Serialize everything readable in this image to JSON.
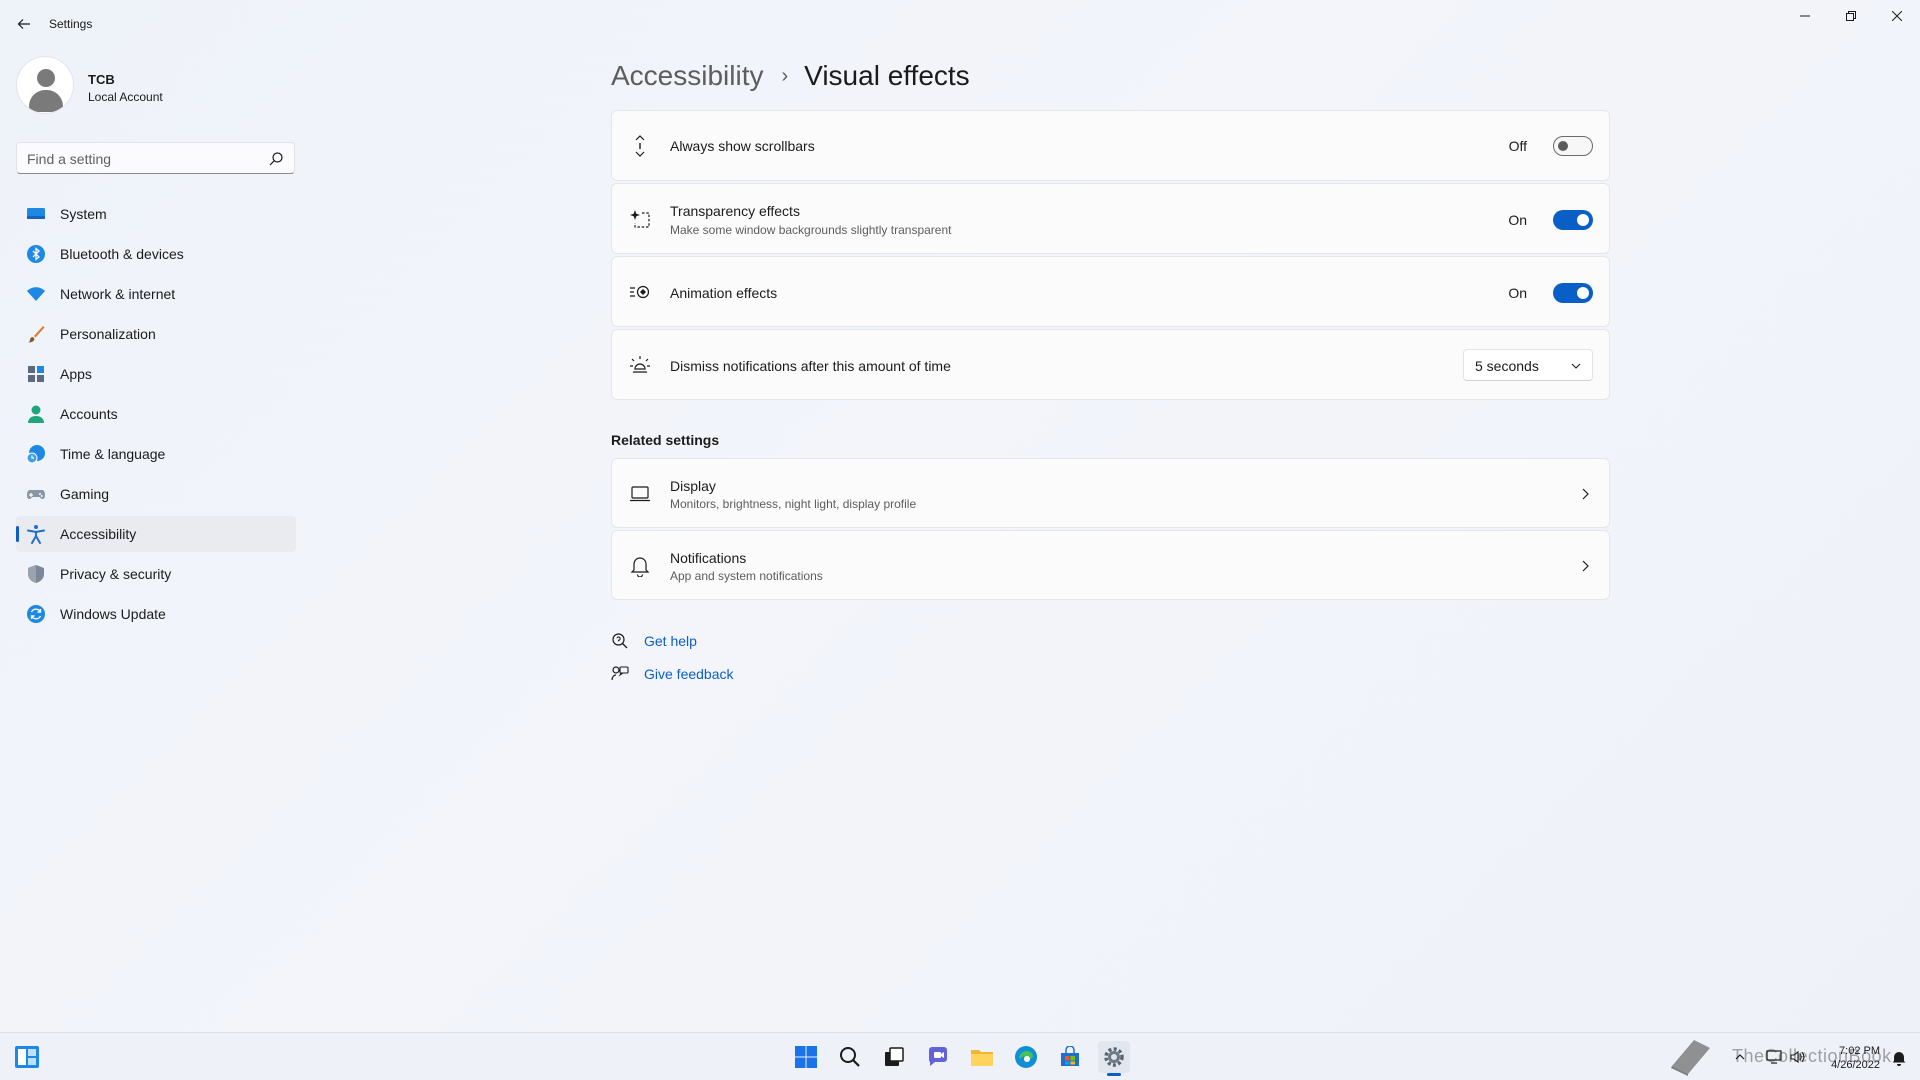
{
  "window": {
    "title": "Settings"
  },
  "profile": {
    "name": "TCB",
    "account_type": "Local Account"
  },
  "search": {
    "placeholder": "Find a setting"
  },
  "sidebar": {
    "items": [
      {
        "label": "System",
        "icon": "system-icon"
      },
      {
        "label": "Bluetooth & devices",
        "icon": "bluetooth-icon"
      },
      {
        "label": "Network & internet",
        "icon": "wifi-icon"
      },
      {
        "label": "Personalization",
        "icon": "brush-icon"
      },
      {
        "label": "Apps",
        "icon": "apps-icon"
      },
      {
        "label": "Accounts",
        "icon": "accounts-icon"
      },
      {
        "label": "Time & language",
        "icon": "time-language-icon"
      },
      {
        "label": "Gaming",
        "icon": "gamepad-icon"
      },
      {
        "label": "Accessibility",
        "icon": "accessibility-icon",
        "active": true
      },
      {
        "label": "Privacy & security",
        "icon": "shield-icon"
      },
      {
        "label": "Windows Update",
        "icon": "update-icon"
      }
    ]
  },
  "breadcrumb": {
    "parent": "Accessibility",
    "separator": "›",
    "current": "Visual effects"
  },
  "settings": {
    "scrollbars": {
      "title": "Always show scrollbars",
      "state": "Off",
      "on": false
    },
    "transparency": {
      "title": "Transparency effects",
      "description": "Make some window backgrounds slightly transparent",
      "state": "On",
      "on": true
    },
    "animation": {
      "title": "Animation effects",
      "state": "On",
      "on": true
    },
    "notifications_dismiss": {
      "title": "Dismiss notifications after this amount of time",
      "value": "5 seconds"
    }
  },
  "related": {
    "heading": "Related settings",
    "display": {
      "title": "Display",
      "description": "Monitors, brightness, night light, display profile"
    },
    "notifications": {
      "title": "Notifications",
      "description": "App and system notifications"
    }
  },
  "help": {
    "get_help": "Get help",
    "give_feedback": "Give feedback"
  },
  "taskbar": {
    "clock_time": "7:02 PM",
    "clock_date": "4/26/2022",
    "watermark": "TheCollectionBook"
  },
  "colors": {
    "accent": "#0a5fc6",
    "background": "#f3f5fb",
    "card": "#fbfbfc"
  }
}
